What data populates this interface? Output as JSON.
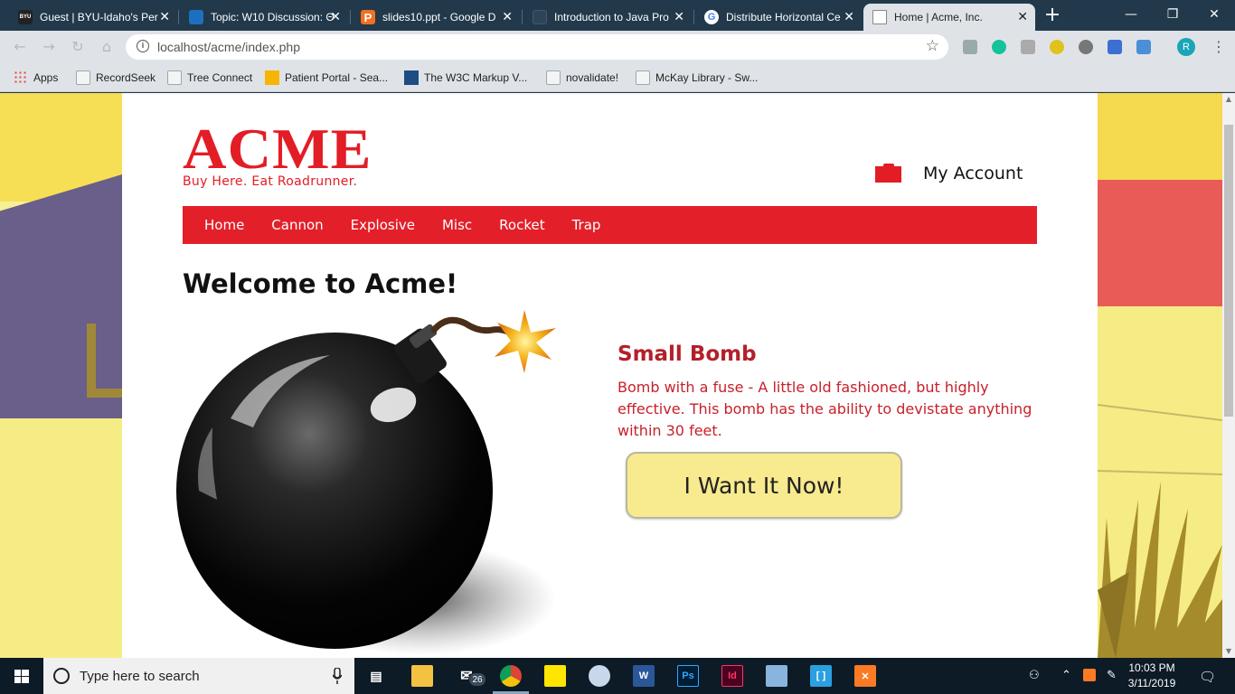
{
  "browser": {
    "tabs": [
      {
        "title": "Guest | BYU-Idaho's Per",
        "favicon": "byu-idaho-icon"
      },
      {
        "title": "Topic: W10 Discussion: Θ",
        "favicon": "canvas-icon"
      },
      {
        "title": "slides10.ppt - Google D",
        "favicon": "p-icon"
      },
      {
        "title": "Introduction to Java Pro",
        "favicon": "page-icon"
      },
      {
        "title": "Distribute Horizontal Ce",
        "favicon": "google-icon"
      },
      {
        "title": "Home | Acme, Inc.",
        "favicon": "page-icon"
      }
    ],
    "active_tab_index": 5,
    "url": "localhost/acme/index.php",
    "profile_initial": "R",
    "bookmarks": [
      {
        "label": "Apps"
      },
      {
        "label": "RecordSeek"
      },
      {
        "label": "Tree Connect"
      },
      {
        "label": "Patient Portal - Sea..."
      },
      {
        "label": "The W3C Markup V..."
      },
      {
        "label": "novalidate!"
      },
      {
        "label": "McKay Library - Sw..."
      }
    ]
  },
  "site": {
    "logo_text": "ACME",
    "tagline": "Buy Here. Eat Roadrunner.",
    "account_label": "My Account",
    "nav": [
      "Home",
      "Cannon",
      "Explosive",
      "Misc",
      "Rocket",
      "Trap"
    ],
    "welcome_heading": "Welcome to Acme!",
    "product": {
      "name": "Small Bomb",
      "description": "Bomb with a fuse - A little old fashioned, but highly effective. This bomb has the ability to devistate anything within 30 feet.",
      "cta": "I Want It Now!"
    },
    "colors": {
      "brand_red": "#e31d25",
      "button_yellow": "#f8ea8e"
    }
  },
  "taskbar": {
    "search_placeholder": "Type here to search",
    "mail_badge": "26",
    "time": "10:03 PM",
    "date": "3/11/2019"
  }
}
